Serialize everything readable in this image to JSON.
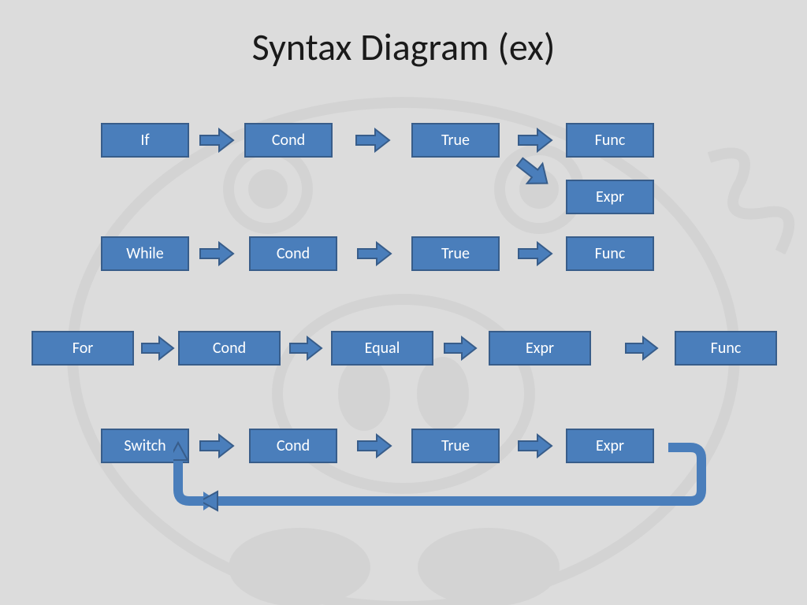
{
  "title": "Syntax Diagram (ex)",
  "colors": {
    "box_fill": "#4a7ebb",
    "box_border": "#385d8a",
    "bg": "#dcdcdc"
  },
  "rows": {
    "row1": {
      "nodes": [
        "If",
        "Cond",
        "True",
        "Func"
      ],
      "branch_below_last": "Expr"
    },
    "row2": {
      "nodes": [
        "While",
        "Cond",
        "True",
        "Func"
      ]
    },
    "row3": {
      "nodes": [
        "For",
        "Cond",
        "Equal",
        "Expr",
        "Func"
      ]
    },
    "row4": {
      "nodes": [
        "Switch",
        "Cond",
        "True",
        "Expr"
      ],
      "loopback_to_first": true
    }
  }
}
